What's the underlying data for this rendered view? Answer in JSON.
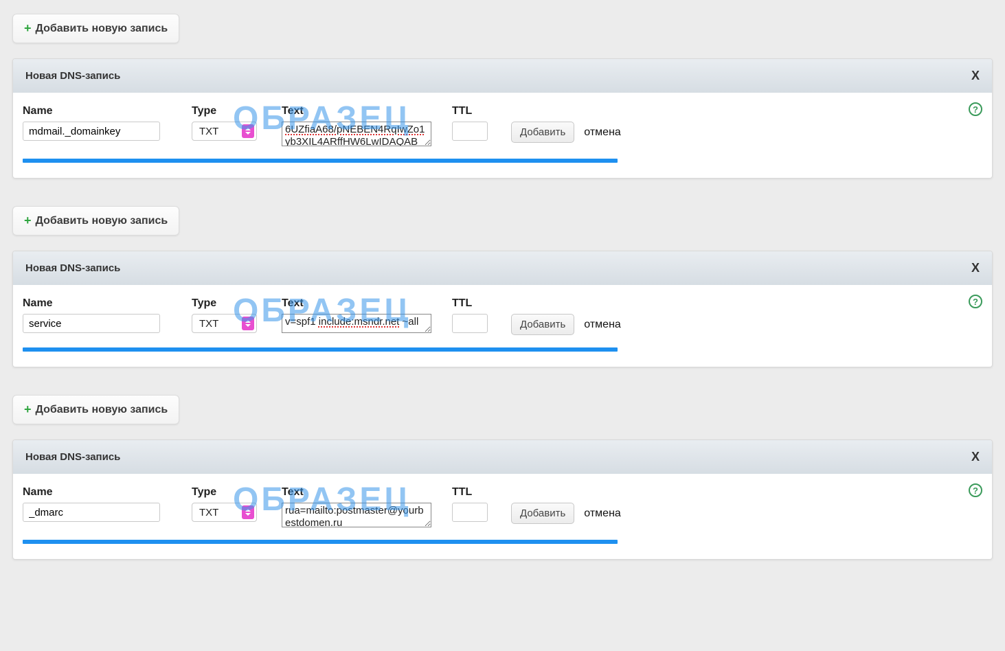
{
  "add_button_label": "Добавить новую запись",
  "panel_title": "Новая DNS-запись",
  "close_label": "X",
  "watermark": "ОБРАЗЕЦ",
  "labels": {
    "name": "Name",
    "type": "Type",
    "text": "Text",
    "ttl": "TTL"
  },
  "type_option": "TXT",
  "submit_label": "Добавить",
  "cancel_label": "отмена",
  "help_label": "?",
  "records": [
    {
      "name": "mdmail._domainkey",
      "text": "6UZfiaA68/pNEBEN4RqIwZo1yb3XIL4ARffHW6LwIDAQAB",
      "ttl": "",
      "text_lines": 2,
      "underline_text": true
    },
    {
      "name": "service",
      "text": "v=spf1 include:msndr.net ~all",
      "ttl": "",
      "text_lines": 1,
      "underline_text": false,
      "underline_segment": "include:msndr.net"
    },
    {
      "name": "_dmarc",
      "text": "rua=mailto:postmaster@yourbestdomen.ru",
      "ttl": "",
      "text_lines": 2,
      "underline_text": false
    }
  ]
}
